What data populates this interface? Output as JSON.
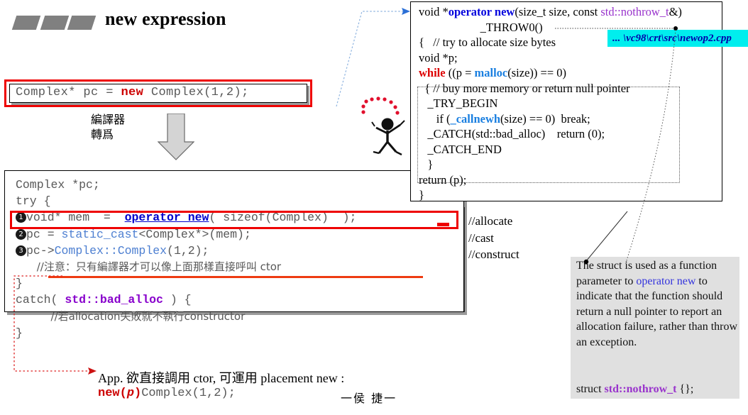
{
  "slide": {
    "title": "new expression",
    "bullet_icon": "three-parallelograms-icon"
  },
  "top_expression": {
    "code_before": "Complex* pc = ",
    "keyword": "new",
    "code_after": " Complex(1,2);",
    "highlight_color": "#ee0000"
  },
  "compiler_note": {
    "line1": "編譯器",
    "line2": "轉爲",
    "arrow_icon": "down-arrow-icon"
  },
  "main_code": {
    "lines": [
      {
        "num": "",
        "text": "Complex *pc;"
      },
      {
        "num": "",
        "text": "try {"
      },
      {
        "num": "1",
        "text": "void* mem  =  operator new( sizeof(Complex)  );"
      },
      {
        "num": "2",
        "text": "pc = static_cast<Complex*>(mem);"
      },
      {
        "num": "3",
        "text": "pc->Complex::Complex(1,2);"
      },
      {
        "num": "",
        "text": "//注意：只有編譯器才可以像上面那樣直接呼叫 ctor"
      },
      {
        "num": "",
        "text": "}"
      },
      {
        "num": "",
        "text": "catch( std::bad_alloc ) {"
      },
      {
        "num": "",
        "text": "//若allocation失敗就不執行constructor"
      },
      {
        "num": "",
        "text": "}"
      }
    ],
    "side_comments": [
      "//allocate",
      "//cast",
      "//construct"
    ]
  },
  "operator_new_source": {
    "signature_pre": "void *",
    "signature_name": "operator new",
    "signature_args_pre": "(size_t size, const ",
    "signature_type": "std::nothrow_t",
    "signature_args_post": "&)",
    "throw_spec": "_THROW0()",
    "body": [
      "{   // try to allocate size bytes",
      "void *p;",
      "while ((p = malloc(size)) == 0)",
      "  { // buy more memory or return null pointer",
      "   _TRY_BEGIN",
      "      if (_callnewh(size) == 0)  break;",
      "   _CATCH(std::bad_alloc)    return (0);",
      "   _CATCH_END",
      "   }",
      "return (p);",
      "}"
    ],
    "file_label": "... \\vc98\\crt\\src\\newop2.cpp"
  },
  "explanation": {
    "text_pre": "The struct is used as a function parameter to ",
    "link": "operator new",
    "text_post": " to indicate that the function should return a null pointer to report an allocation failure, rather than throw an exception.",
    "struct_pre": "struct ",
    "struct_name": "std::nothrow_t",
    "struct_post": " {};",
    "background_color": "#e0e0e0"
  },
  "bottom_note": {
    "line1": "App. 欲直接調用 ctor, 可運用 placement new :",
    "line2_keyword": "new(",
    "line2_param": "p",
    "line2_close": ")",
    "line2_rest": "Complex(1,2);",
    "signature": "一侯 捷一"
  },
  "icons": {
    "stick_figure": "stick-figure-icon",
    "explosion_dots": "red-dots-arc-icon",
    "arrow_to_source": "blue-dotted-arrow-icon",
    "arrow_to_bottom": "red-dotted-arrow-icon",
    "leader_to_explanation": "dotted-leader-line-icon"
  },
  "colors": {
    "red_highlight": "#ee0000",
    "keyword_red": "#cc0000",
    "operator_blue": "#0000cc",
    "type_purple": "#9933cc",
    "cyan_label": "#00eeee",
    "gray_box": "#e0e0e0"
  }
}
